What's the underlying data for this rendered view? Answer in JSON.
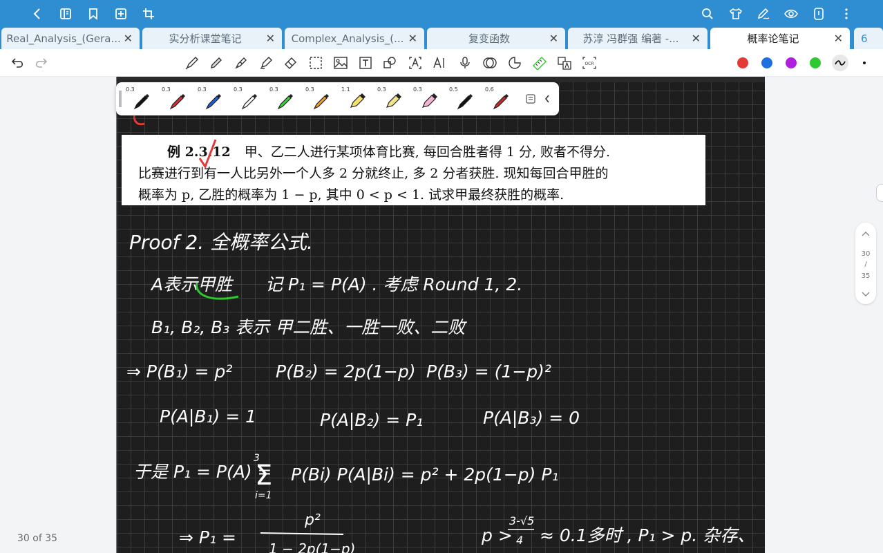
{
  "tabs": [
    {
      "label": "Real_Analysis_(Gera...",
      "active": false
    },
    {
      "label": "实分析课堂笔记",
      "active": false
    },
    {
      "label": "Complex_Analysis_(...",
      "active": false
    },
    {
      "label": "复变函数",
      "active": false
    },
    {
      "label": "苏淳 冯群强 编著 -...",
      "active": false
    },
    {
      "label": "概率论笔记",
      "active": true
    }
  ],
  "extra_tab": "6",
  "colors": {
    "header": "#2f8ed1",
    "red": "#e53935",
    "blue": "#1e6fe0",
    "purple": "#b01ee0",
    "green": "#2ec832"
  },
  "pens": [
    {
      "width": "0.3",
      "color": "#111111",
      "kind": "pen"
    },
    {
      "width": "0.3",
      "color": "#d32f2f",
      "kind": "pen"
    },
    {
      "width": "0.3",
      "color": "#1e5fd0",
      "kind": "pen"
    },
    {
      "width": "0.3",
      "color": "#ffffff",
      "kind": "pen"
    },
    {
      "width": "0.3",
      "color": "#3ad13a",
      "kind": "pen"
    },
    {
      "width": "0.3",
      "color": "#f0a020",
      "kind": "pen"
    },
    {
      "width": "1.1",
      "color": "#f4e06a",
      "kind": "marker"
    },
    {
      "width": "0.3",
      "color": "#f3e38a",
      "kind": "marker"
    },
    {
      "width": "0.3",
      "color": "#f3b2d6",
      "kind": "marker"
    },
    {
      "width": "0.5",
      "color": "#111111",
      "kind": "pen"
    },
    {
      "width": "0.6",
      "color": "#c62828",
      "kind": "pen"
    }
  ],
  "excerpt": {
    "example_label": "例 2.3.12",
    "line1": "甲、乙二人进行某项体育比赛, 每回合胜者得 1 分, 败者不得分.",
    "line2": "比赛进行到有一人比另外一个人多 2 分就终止, 多 2 分者获胜. 现知每回合甲胜的",
    "line3": "概率为 p, 乙胜的概率为 1 − p, 其中 0 < p < 1. 试求甲最终获胜的概率."
  },
  "page_indicator": {
    "current": "30",
    "total": "35"
  },
  "page_count": "30 of 35"
}
